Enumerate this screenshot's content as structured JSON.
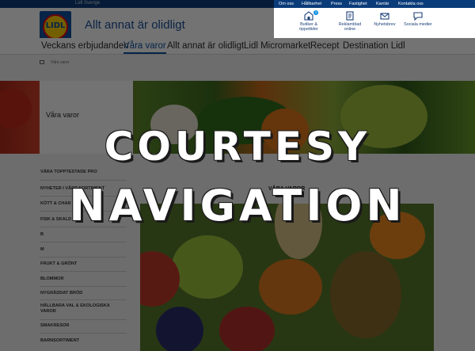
{
  "site": {
    "country_label": "Lidl Sverige",
    "logo_text": "LIDL",
    "tagline": "Allt annat är olidligt"
  },
  "main_nav": [
    {
      "label": "Veckans erbjudanden",
      "active": false
    },
    {
      "label": "Våra varor",
      "active": true
    },
    {
      "label": "Allt annat är olidligt",
      "active": false
    },
    {
      "label": "Lidl Micromarket",
      "active": false
    },
    {
      "label": "Recept",
      "active": false
    },
    {
      "label": "Destination Lidl",
      "active": false
    }
  ],
  "breadcrumb": "Våra varor",
  "hero_panel_title": "Våra varor",
  "section_title": "VÅRA VAROR",
  "sidebar_categories": [
    "VÅRA TOPPTESTADE PRO",
    "NYHETER I VÅRT SORTIMENT",
    "KÖTT & CHAR",
    "FISK & SKALD",
    "B",
    "M",
    "FRUKT & GRÖNT",
    "BLOMMOR",
    "NYGRÄDDAT BRÖD",
    "HÅLLBARA VAL & EKOLOGISKA VAROR",
    "SMAKRESOR",
    "BARNSORTIMENT"
  ],
  "courtesy_nav": {
    "top_links": [
      "Om oss",
      "Hållbarhet",
      "Press",
      "Fastighet",
      "Karriär",
      "Kontakta oss"
    ],
    "services": [
      {
        "label": "Butiker & öppettider",
        "icon": "store-pin-icon",
        "badge": "1"
      },
      {
        "label": "Reklamblad online",
        "icon": "leaflet-icon"
      },
      {
        "label": "Nyhetsbrev",
        "icon": "newsletter-icon"
      },
      {
        "label": "Sociala medier",
        "icon": "chat-bubble-icon"
      }
    ]
  },
  "headline": {
    "line1": "COURTESY",
    "line2": "NAVIGATION"
  },
  "colors": {
    "brand_blue": "#0b50a0",
    "brand_yellow": "#ffd400",
    "brand_red": "#e60a14",
    "dark_bar": "#0b3c7a"
  }
}
